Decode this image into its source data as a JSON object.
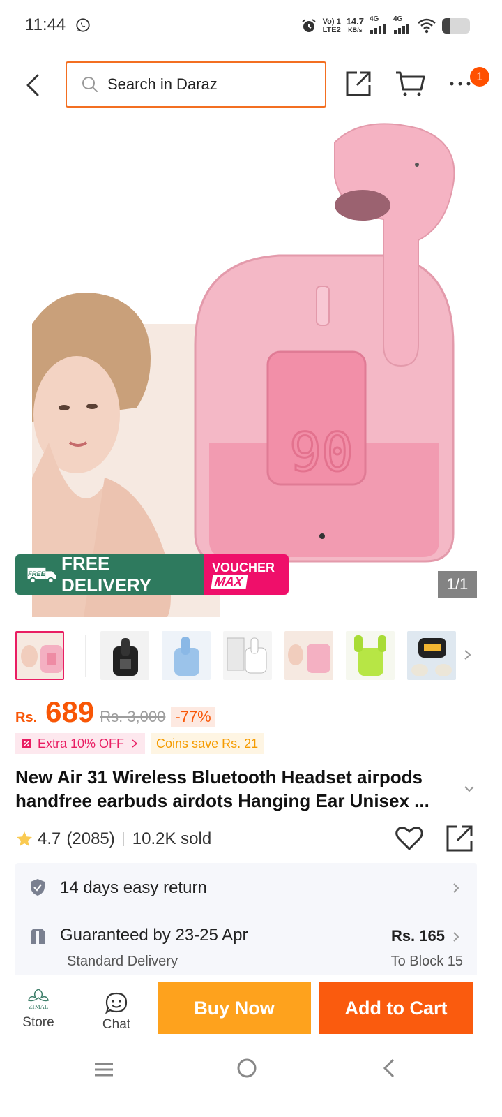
{
  "status_bar": {
    "time": "11:44",
    "net_line1": "Vo) 1",
    "net_line2": "LTE2",
    "speed_value": "14.7",
    "speed_unit": "KB/s",
    "sig1": "4G",
    "sig2": "4G",
    "battery_level": 0.3
  },
  "nav": {
    "search_placeholder": "Search in Daraz",
    "cart_count": "1"
  },
  "hero": {
    "promo_free": "FREE DELIVERY",
    "promo_free_small": "FREE",
    "promo_voucher_line1": "VOUCHER",
    "promo_voucher_line2": "MAX",
    "image_counter": "1/1",
    "case_display": "90"
  },
  "product": {
    "currency": "Rs.",
    "price": "689",
    "old_price": "Rs. 3,000",
    "discount": "-77%",
    "extra_tag": "Extra 10% OFF",
    "coins_tag": "Coins save Rs. 21",
    "title": "New Air 31 Wireless Bluetooth Headset airpods handfree earbuds airdots Hanging Ear Unisex ...",
    "rating": "4.7",
    "reviews": "(2085)",
    "sold": "10.2K sold"
  },
  "services": {
    "return_text": "14 days easy return",
    "delivery_text": "Guaranteed by 23-25 Apr",
    "delivery_sub": "Standard Delivery",
    "delivery_fee": "Rs. 165",
    "delivery_to": "To Block 15"
  },
  "bottom_bar": {
    "store_label": "Store",
    "store_logo_text": "ZIMAL",
    "chat_label": "Chat",
    "buy_now": "Buy Now",
    "add_to_cart": "Add to Cart"
  },
  "colors": {
    "brand_orange": "#f85606",
    "buy_now_bg": "#fea21d",
    "add_to_cart_bg": "#fa5b0e",
    "delivery_green": "#2e7a5e",
    "voucher_pink": "#ef0f6a"
  },
  "thumbnails": [
    "pink-earbuds-model",
    "black-earbuds",
    "blue-earbuds",
    "white-earbuds-box",
    "pink-earbuds-model-2",
    "green-earbuds",
    "yellow-earbuds-case"
  ]
}
